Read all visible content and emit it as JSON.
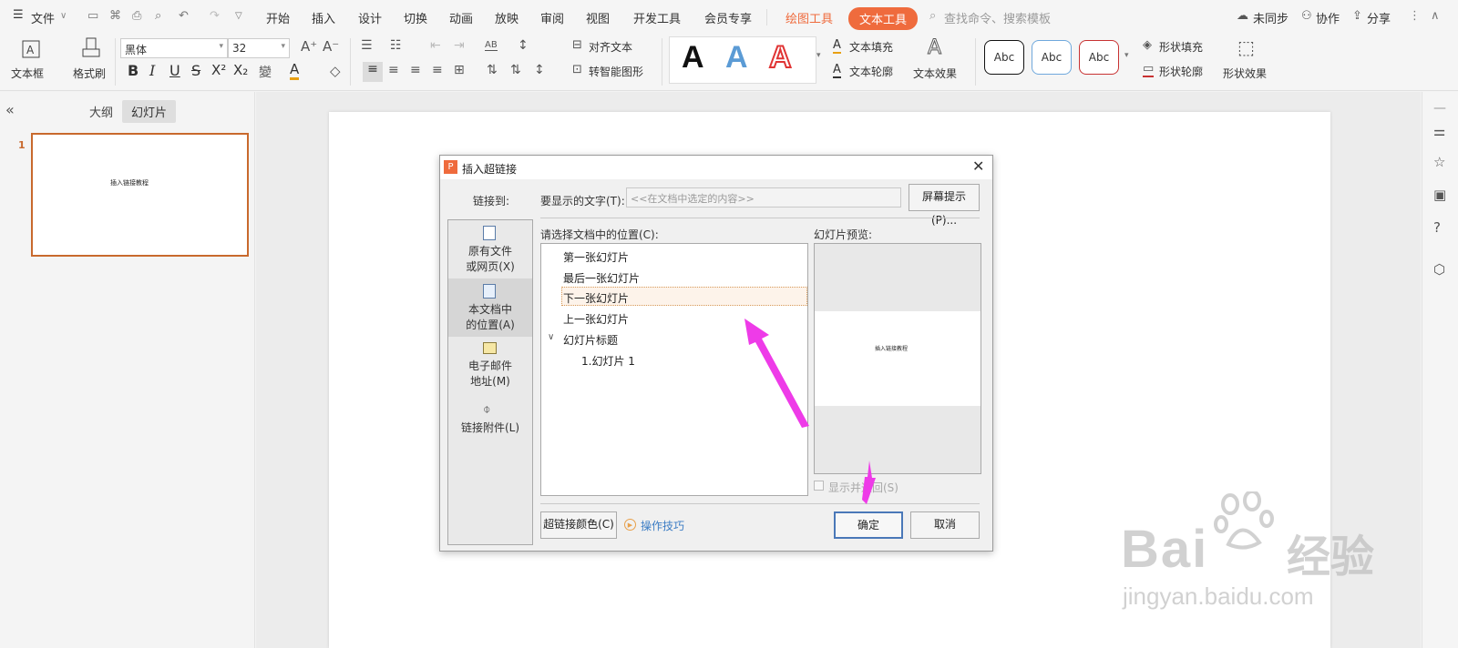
{
  "menubar": {
    "file": "文件",
    "tabs": [
      "开始",
      "插入",
      "设计",
      "切换",
      "动画",
      "放映",
      "审阅",
      "视图",
      "开发工具",
      "会员专享"
    ],
    "drawing_tools": "绘图工具",
    "text_tools": "文本工具",
    "search_placeholder": "查找命令、搜索模板",
    "unsynced": "未同步",
    "collaborate": "协作",
    "share": "分享"
  },
  "ribbon": {
    "textbox": "文本框",
    "format_painter": "格式刷",
    "font_name": "黑体",
    "font_size": "32",
    "align_text": "对齐文本",
    "smart_shape": "转智能图形",
    "text_fill": "文本填充",
    "text_outline": "文本轮廓",
    "text_effect": "文本效果",
    "shape_fill": "形状填充",
    "shape_outline": "形状轮廓",
    "shape_effect": "形状效果",
    "style_sample": "Abc",
    "bold": "B",
    "italic": "I",
    "underline": "U",
    "strike": "S",
    "superscript": "X²",
    "subscript": "X₂",
    "big_a": "A"
  },
  "leftpane": {
    "outline_tab": "大纲",
    "slides_tab": "幻灯片",
    "slide_number": "1",
    "slide_thumb_text": "插入链接教程"
  },
  "dialog": {
    "title": "插入超链接",
    "link_to": "链接到:",
    "display_text_label": "要显示的文字(T):",
    "display_text_placeholder": "<<在文档中选定的内容>>",
    "screen_tip": "屏幕提示(P)...",
    "side": [
      {
        "line1": "原有文件",
        "line2": "或网页(X)"
      },
      {
        "line1": "本文档中",
        "line2": "的位置(A)"
      },
      {
        "line1": "电子邮件",
        "line2": "地址(M)"
      },
      {
        "line1": "链接附件(L)",
        "line2": ""
      }
    ],
    "choose_location": "请选择文档中的位置(C):",
    "locations": [
      "第一张幻灯片",
      "最后一张幻灯片",
      "下一张幻灯片",
      "上一张幻灯片"
    ],
    "slide_titles": "幻灯片标题",
    "slide_item": "1.幻灯片 1",
    "preview_label": "幻灯片预览:",
    "preview_text": "插入链接教程",
    "show_return": "显示并返回(S)",
    "link_color": "超链接颜色(C)",
    "tips": "操作技巧",
    "ok": "确定",
    "cancel": "取消"
  },
  "watermark": {
    "brand": "Bai",
    "brand2": "经验",
    "url": "jingyan.baidu.com"
  },
  "colors": {
    "accent_orange": "#ef6b3d",
    "arrow_magenta": "#ee3be8",
    "selection_border": "#d79a5a"
  }
}
